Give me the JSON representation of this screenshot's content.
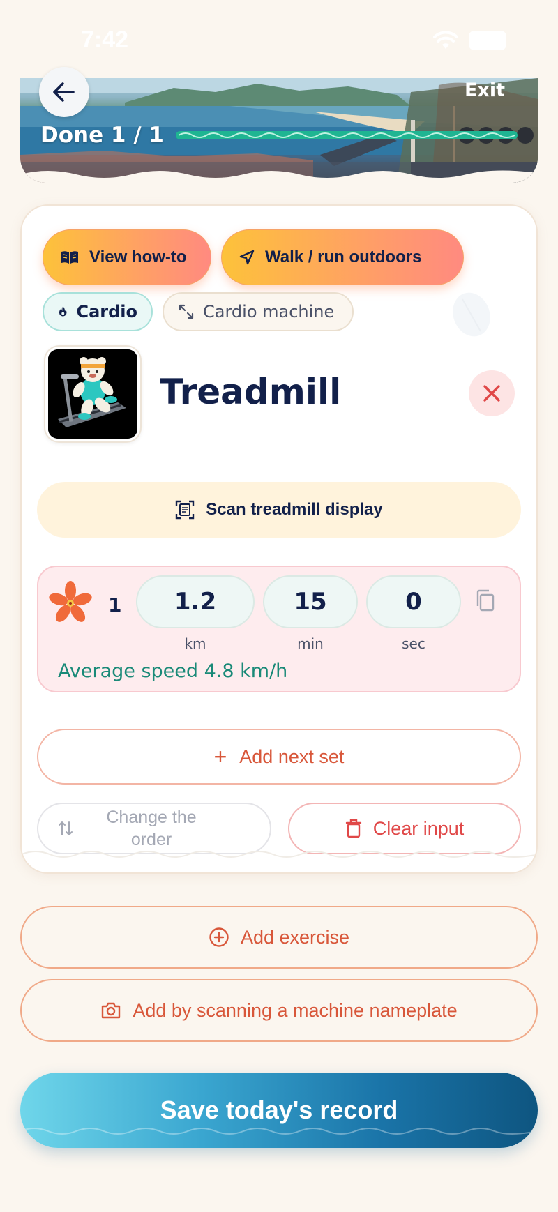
{
  "status_bar": {
    "time": "7:42"
  },
  "header": {
    "exit_label": "Exit",
    "done_label": "Done 1 / 1",
    "progress": 1.0
  },
  "exercise": {
    "chips": {
      "how_to": "View how-to",
      "outdoors": "Walk / run outdoors"
    },
    "tags": {
      "category": "Cardio",
      "equipment": "Cardio machine"
    },
    "name": "Treadmill",
    "scan_display_label": "Scan treadmill display",
    "sets": [
      {
        "number": "1",
        "distance": "1.2",
        "distance_unit": "km",
        "minutes": "15",
        "minutes_unit": "min",
        "seconds": "0",
        "seconds_unit": "sec",
        "average_speed": "Average speed 4.8 km/h"
      }
    ],
    "add_set_label": "Add next set",
    "change_order_label": "Change the order",
    "clear_input_label": "Clear input"
  },
  "actions": {
    "add_exercise": "Add exercise",
    "scan_nameplate": "Add by scanning a machine nameplate",
    "save": "Save today's record"
  },
  "colors": {
    "accent_orange": "#d8573a",
    "teal": "#1a8a78",
    "navy": "#12204a",
    "danger": "#e04848"
  }
}
